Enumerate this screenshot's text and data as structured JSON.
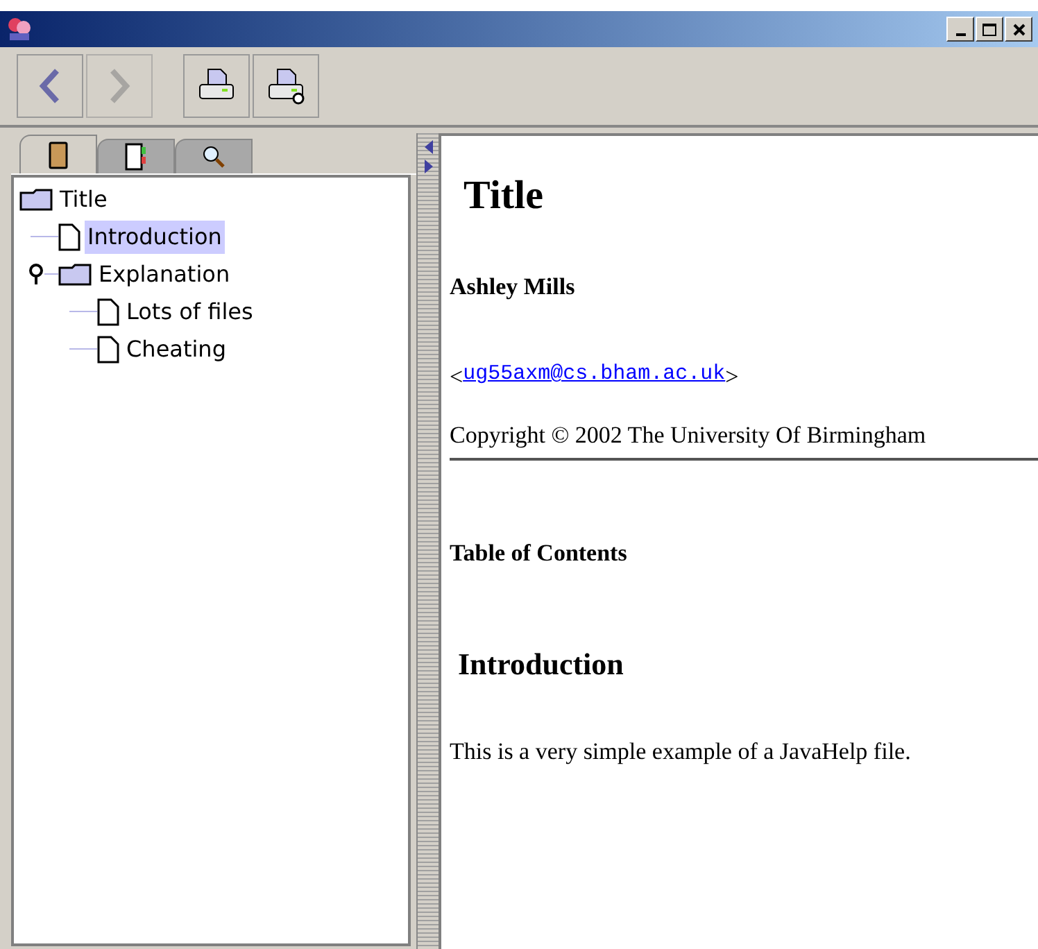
{
  "toolbar": [
    {
      "kind": "back",
      "disabled": false
    },
    {
      "kind": "forward",
      "disabled": true
    },
    {
      "kind": "print",
      "disabled": false
    },
    {
      "kind": "print-setup",
      "disabled": false
    }
  ],
  "tabs": [
    {
      "kind": "book",
      "selected": true
    },
    {
      "kind": "index",
      "selected": false
    },
    {
      "kind": "search",
      "selected": false
    }
  ],
  "tree": [
    {
      "label": "Title",
      "kind": "folder",
      "selected": false,
      "children": [
        {
          "label": "Introduction",
          "kind": "page",
          "selected": true
        },
        {
          "label": "Explanation",
          "kind": "folder",
          "selected": false,
          "expanded": true,
          "children": [
            {
              "label": "Lots of files",
              "kind": "page",
              "selected": false
            },
            {
              "label": "Cheating",
              "kind": "page",
              "selected": false
            }
          ]
        }
      ]
    }
  ],
  "content": [
    {
      "kind": "h1",
      "text": "Title"
    },
    {
      "kind": "author",
      "text": "Ashley Mills"
    },
    {
      "kind": "email",
      "prefix": "<",
      "link": "ug55axm@cs.bham.ac.uk",
      "suffix": ">"
    },
    {
      "kind": "copyright",
      "text": "Copyright © 2002 The University Of Birmingham"
    },
    {
      "kind": "h3",
      "text": "Table of Contents"
    },
    {
      "kind": "h2",
      "text": "Introduction"
    },
    {
      "kind": "p",
      "text": "This is a very simple example of a JavaHelp file."
    }
  ]
}
